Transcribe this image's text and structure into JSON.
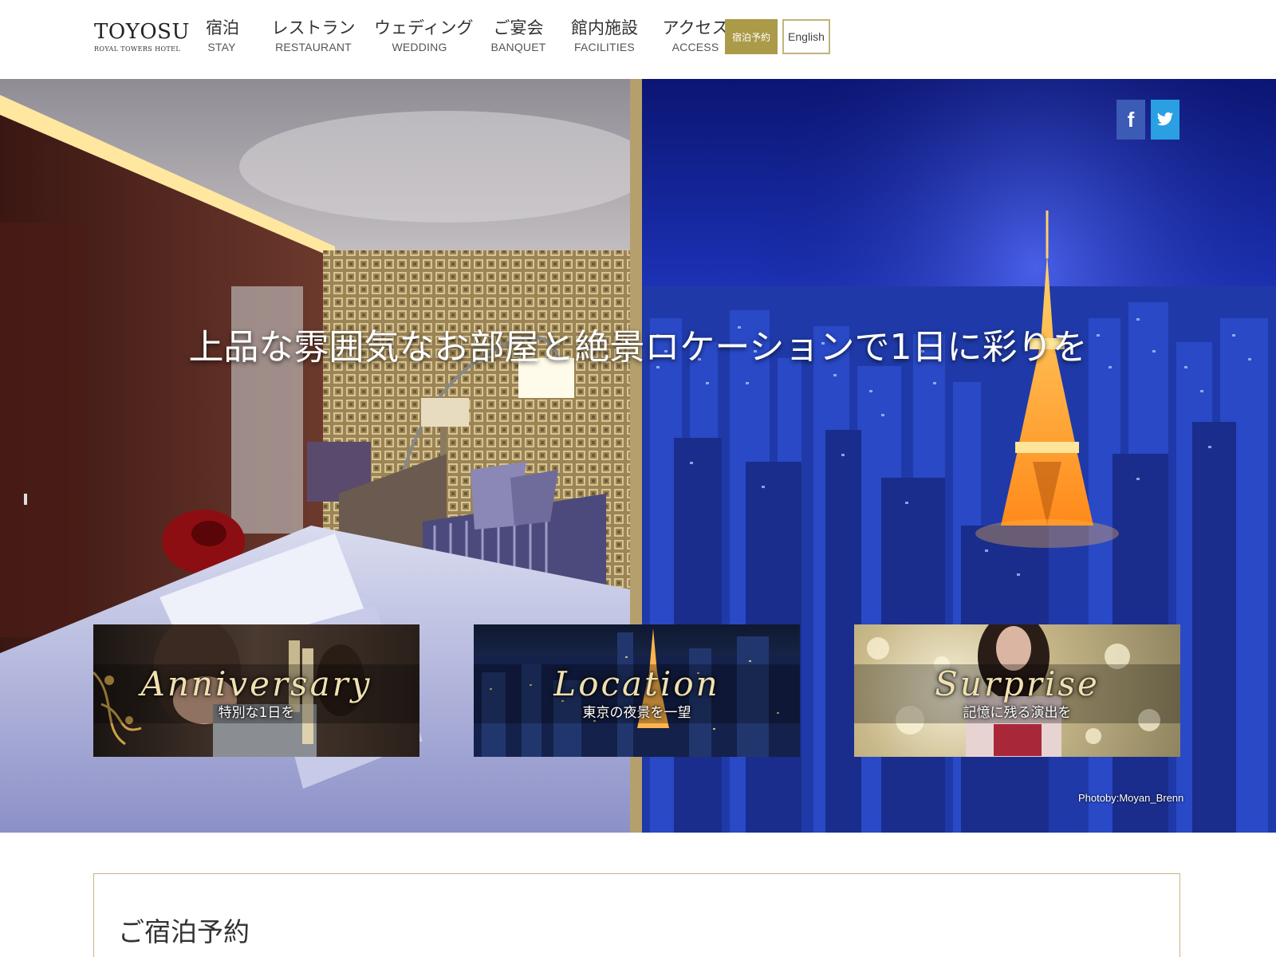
{
  "header": {
    "logo": {
      "name": "TOYOSU",
      "sub": "ROYAL TOWERS HOTEL"
    },
    "nav": [
      {
        "jp": "宿泊",
        "en": "STAY"
      },
      {
        "jp": "レストラン",
        "en": "RESTAURANT"
      },
      {
        "jp": "ウェディング",
        "en": "WEDDING"
      },
      {
        "jp": "ご宴会",
        "en": "BANQUET"
      },
      {
        "jp": "館内施設",
        "en": "FACILITIES"
      },
      {
        "jp": "アクセス",
        "en": "ACCESS"
      }
    ],
    "reserve_label": "宿泊予約",
    "english_label": "English"
  },
  "hero": {
    "title": "上品な雰囲気なお部屋と絶景ロケーションで1日に彩りを",
    "social": {
      "facebook_icon": "f",
      "twitter_icon": "twitter-bird"
    },
    "cards": [
      {
        "title": "Anniversary",
        "subtitle": "特別な1日を"
      },
      {
        "title": "Location",
        "subtitle": "東京の夜景を一望"
      },
      {
        "title": "Surprise",
        "subtitle": "記憶に残る演出を"
      }
    ],
    "photo_credit": "Photoby:Moyan_Brenn"
  },
  "reservation": {
    "title": "ご宿泊予約"
  },
  "colors": {
    "gold": "#ab9a47",
    "gold_border": "#c2b37a",
    "facebook": "#3b5bb5",
    "twitter": "#2aa0e2"
  }
}
